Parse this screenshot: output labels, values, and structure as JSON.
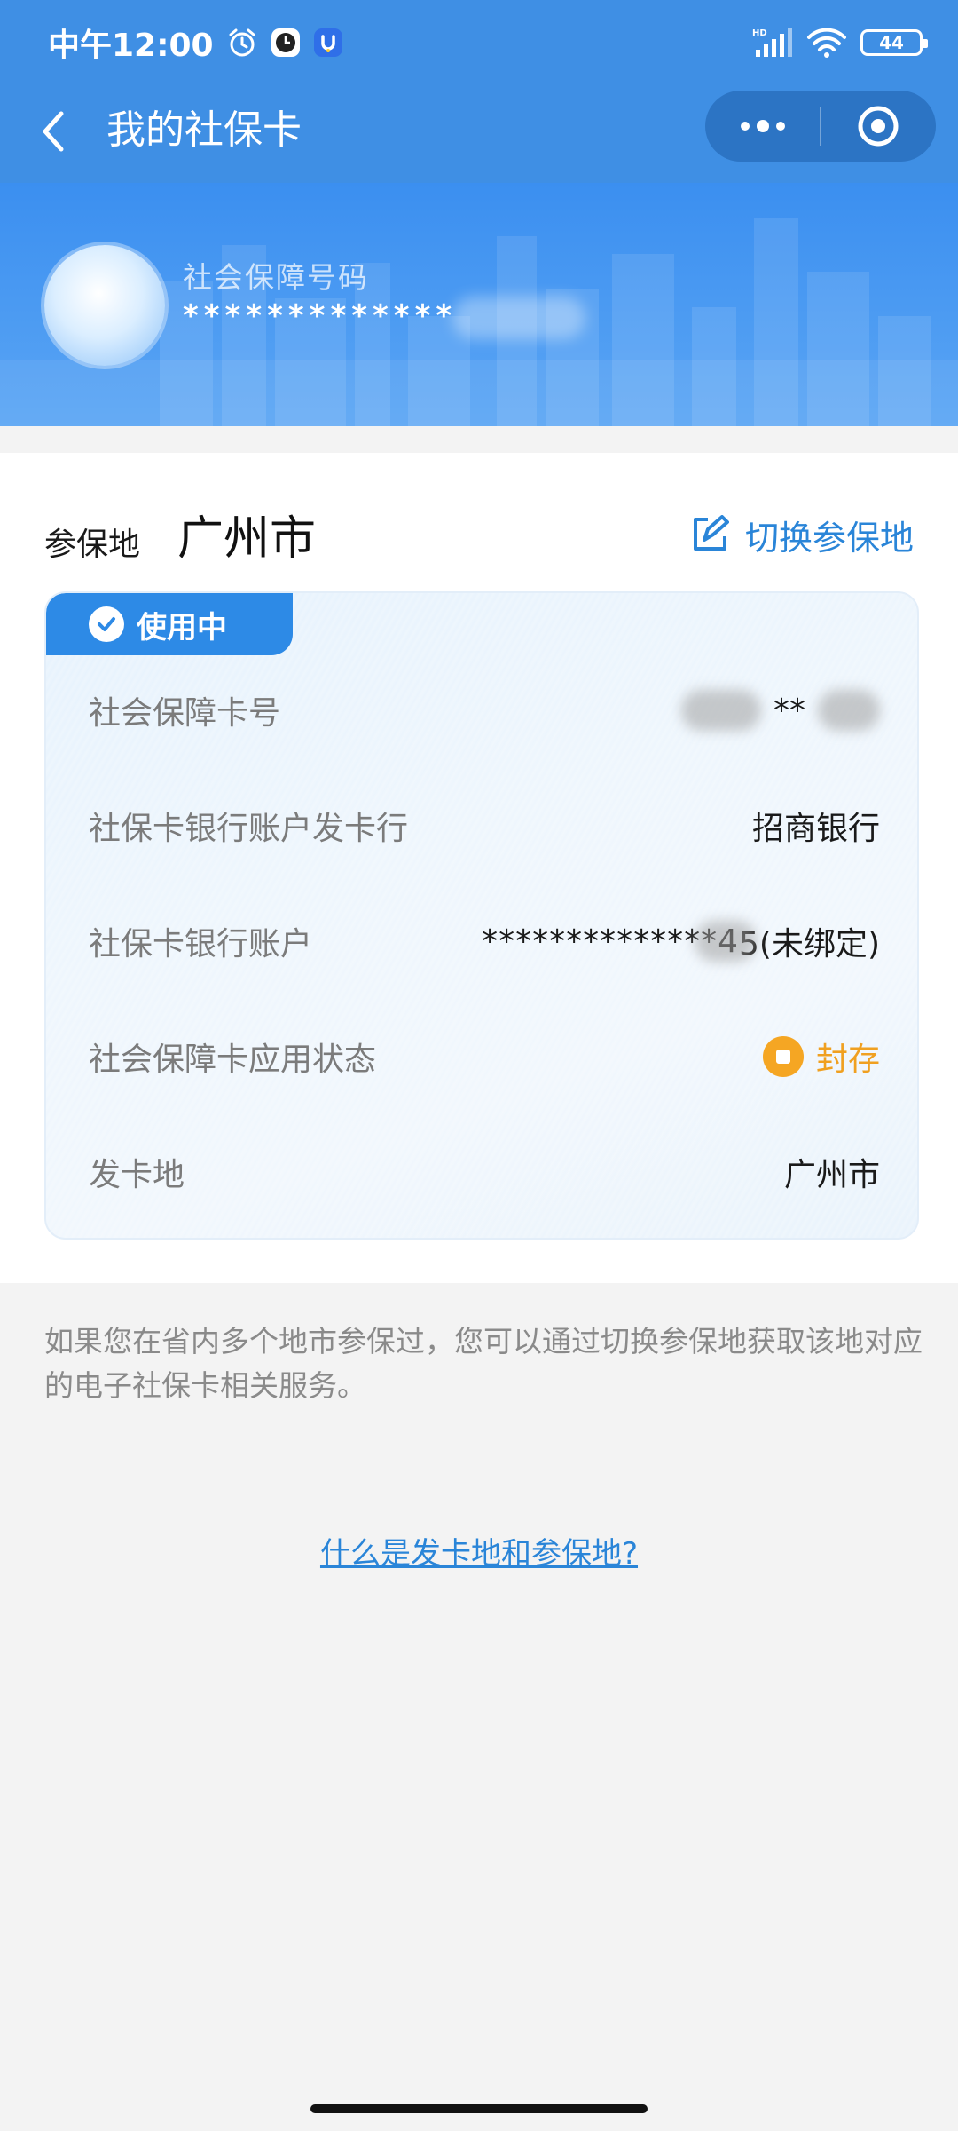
{
  "status_bar": {
    "time": "中午12:00",
    "battery": "44"
  },
  "nav": {
    "title": "我的社保卡"
  },
  "header": {
    "ssn_label": "社会保障号码",
    "ssn_value": "*************"
  },
  "region": {
    "label": "参保地",
    "value": "广州市",
    "switch_label": "切换参保地"
  },
  "card": {
    "badge": "使用中",
    "rows": [
      {
        "label": "社会保障卡号",
        "value": "**"
      },
      {
        "label": "社保卡银行账户发卡行",
        "value": "招商银行"
      },
      {
        "label": "社保卡银行账户",
        "value_prefix": "**************4",
        "value_suffix": "5(未绑定)"
      },
      {
        "label": "社会保障卡应用状态",
        "value": "封存"
      },
      {
        "label": "发卡地",
        "value": "广州市"
      }
    ]
  },
  "note": "如果您在省内多个地市参保过，您可以通过切换参保地获取该地对应的电子社保卡相关服务。",
  "help_link": "什么是发卡地和参保地?",
  "colors": {
    "primary": "#3f8fe4",
    "badge": "#2d8ae6",
    "link": "#2a85d8",
    "status_warning": "#f5a623"
  }
}
